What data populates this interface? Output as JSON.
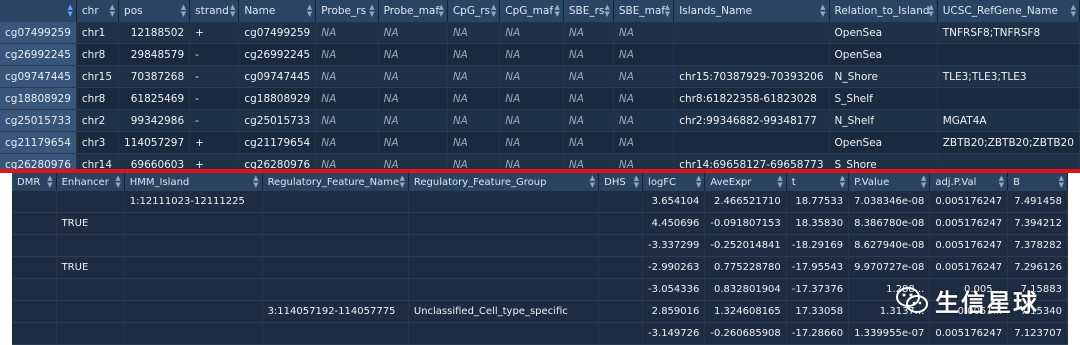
{
  "top_table": {
    "headers": [
      "",
      "chr",
      "pos",
      "strand",
      "Name",
      "Probe_rs",
      "Probe_maf",
      "CpG_rs",
      "CpG_maf",
      "SBE_rs",
      "SBE_maf",
      "Islands_Name",
      "Relation_to_Island",
      "UCSC_RefGene_Name"
    ],
    "rows": [
      [
        "cg07499259",
        "chr1",
        "12188502",
        "+",
        "cg07499259",
        "NA",
        "NA",
        "NA",
        "NA",
        "NA",
        "NA",
        "",
        "OpenSea",
        "TNFRSF8;TNFRSF8"
      ],
      [
        "cg26992245",
        "chr8",
        "29848579",
        "-",
        "cg26992245",
        "NA",
        "NA",
        "NA",
        "NA",
        "NA",
        "NA",
        "",
        "OpenSea",
        ""
      ],
      [
        "cg09747445",
        "chr15",
        "70387268",
        "-",
        "cg09747445",
        "NA",
        "NA",
        "NA",
        "NA",
        "NA",
        "NA",
        "chr15:70387929-70393206",
        "N_Shore",
        "TLE3;TLE3;TLE3"
      ],
      [
        "cg18808929",
        "chr8",
        "61825469",
        "-",
        "cg18808929",
        "NA",
        "NA",
        "NA",
        "NA",
        "NA",
        "NA",
        "chr8:61822358-61823028",
        "S_Shelf",
        ""
      ],
      [
        "cg25015733",
        "chr2",
        "99342986",
        "-",
        "cg25015733",
        "NA",
        "NA",
        "NA",
        "NA",
        "NA",
        "NA",
        "chr2:99346882-99348177",
        "N_Shelf",
        "MGAT4A"
      ],
      [
        "cg21179654",
        "chr3",
        "114057297",
        "+",
        "cg21179654",
        "NA",
        "NA",
        "NA",
        "NA",
        "NA",
        "NA",
        "",
        "OpenSea",
        "ZBTB20;ZBTB20;ZBTB20"
      ],
      [
        "cg26280976",
        "chr14",
        "69660603",
        "+",
        "cg26280976",
        "NA",
        "NA",
        "NA",
        "NA",
        "NA",
        "NA",
        "chr14:69658127-69658773",
        "S_Shore",
        ""
      ]
    ]
  },
  "bottom_table": {
    "headers": [
      "DMR",
      "Enhancer",
      "HMM_Island",
      "Regulatory_Feature_Name",
      "Regulatory_Feature_Group",
      "DHS",
      "logFC",
      "AveExpr",
      "t",
      "P.Value",
      "adj.P.Val",
      "B"
    ],
    "rows": [
      [
        "",
        "",
        "1:12111023-12111225",
        "",
        "",
        "",
        "3.654104",
        "2.466521710",
        "18.77533",
        "7.038346e-08",
        "0.005176247",
        "7.491458"
      ],
      [
        "",
        "TRUE",
        "",
        "",
        "",
        "",
        "4.450696",
        "-0.091807153",
        "18.35830",
        "8.386780e-08",
        "0.005176247",
        "7.394212"
      ],
      [
        "",
        "",
        "",
        "",
        "",
        "",
        "-3.337299",
        "-0.252014841",
        "-18.29169",
        "8.627940e-08",
        "0.005176247",
        "7.378282"
      ],
      [
        "",
        "TRUE",
        "",
        "",
        "",
        "",
        "-2.990263",
        "0.775228780",
        "-17.95543",
        "9.970727e-08",
        "0.005176247",
        "7.296126"
      ],
      [
        "",
        "",
        "",
        "",
        "",
        "",
        "-3.054336",
        "0.832801904",
        "-17.37376",
        "1.288...",
        "0.005...",
        "7.15883"
      ],
      [
        "",
        "",
        "",
        "3:114057192-114057775",
        "Unclassified_Cell_type_specific",
        "",
        "2.859016",
        "1.324608165",
        "17.33058",
        "1.3137...",
        "0.0051...",
        "7.15340"
      ],
      [
        "",
        "",
        "",
        "",
        "",
        "",
        "-3.149726",
        "-0.260685908",
        "-17.28660",
        "1.339955e-07",
        "0.005176247",
        "7.123707"
      ]
    ]
  },
  "watermark": {
    "text": "生信星球",
    "icon": "wechat-logo-icon"
  },
  "colors": {
    "top_bg": "#1b2b3f",
    "header_bg": "#2a4463",
    "separator": "#e0121a",
    "rowname_bg": "#37567a"
  }
}
